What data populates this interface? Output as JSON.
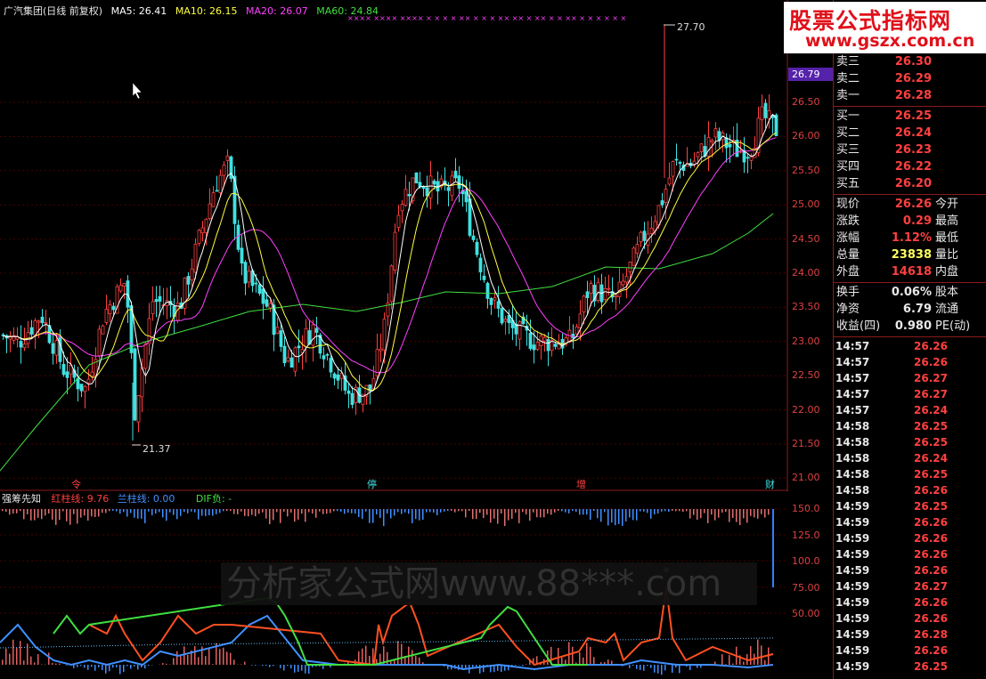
{
  "header": {
    "title": "广汽集团(日线 前复权)",
    "ma5": "MA5: 26.41",
    "ma10": "MA10: 26.15",
    "ma20": "MA20: 26.07",
    "ma60": "MA60: 24.84"
  },
  "colors": {
    "ma5": "#ffffff",
    "ma10": "#ffff40",
    "ma20": "#ff40ff",
    "ma60": "#40e040",
    "up": "#ff4040",
    "down": "#40e0e0"
  },
  "axis": {
    "price_ticks": [
      "26.50",
      "26.00",
      "25.50",
      "25.00",
      "24.50",
      "24.00",
      "23.50",
      "23.00",
      "22.50",
      "22.00",
      "21.50",
      "21.00"
    ],
    "indicator_ticks": [
      "150.0",
      "125.0",
      "100.0",
      "75.00",
      "50.00"
    ],
    "current_price": "26.79"
  },
  "annotations": {
    "high": "27.70",
    "low": "21.37",
    "markers": [
      "令",
      "停",
      "增",
      "财"
    ]
  },
  "indicator": {
    "name": "强筹先知",
    "red_label": "红柱线: 9.76",
    "blue_label": "兰柱线: 0.00",
    "dif_label": "DIF负: -"
  },
  "logo": {
    "line1": "股票公式指标网",
    "line2": "www.gszx.com.cn"
  },
  "watermark": "分析家公式网www.88***.com",
  "quote": {
    "sell": [
      {
        "label": "卖三",
        "value": "26.30"
      },
      {
        "label": "卖二",
        "value": "26.29"
      },
      {
        "label": "卖一",
        "value": "26.28"
      }
    ],
    "buy": [
      {
        "label": "买一",
        "value": "26.25"
      },
      {
        "label": "买二",
        "value": "26.24"
      },
      {
        "label": "买三",
        "value": "26.23"
      },
      {
        "label": "买四",
        "value": "26.22"
      },
      {
        "label": "买五",
        "value": "26.20"
      }
    ],
    "stats": [
      {
        "label": "现价",
        "value": "26.26",
        "right": "今开",
        "color": "#ff4040"
      },
      {
        "label": "涨跌",
        "value": "0.29",
        "right": "最高",
        "color": "#ff4040"
      },
      {
        "label": "涨幅",
        "value": "1.12%",
        "right": "最低",
        "color": "#ff4040"
      },
      {
        "label": "总量",
        "value": "23838",
        "right": "量比",
        "color": "#ffff60"
      },
      {
        "label": "外盘",
        "value": "14618",
        "right": "内盘",
        "color": "#ff4040"
      }
    ],
    "stats2": [
      {
        "label": "换手",
        "value": "0.06%",
        "right": "股本",
        "color": "#e8e8e8"
      },
      {
        "label": "净资",
        "value": "6.79",
        "right": "流通",
        "color": "#e8e8e8"
      },
      {
        "label": "收益(四)",
        "value": "0.980",
        "right": "PE(动)",
        "color": "#e8e8e8"
      }
    ]
  },
  "ticks": [
    {
      "time": "14:57",
      "price": "26.26"
    },
    {
      "time": "14:57",
      "price": "26.26"
    },
    {
      "time": "14:57",
      "price": "26.27"
    },
    {
      "time": "14:57",
      "price": "26.27"
    },
    {
      "time": "14:57",
      "price": "26.24"
    },
    {
      "time": "14:58",
      "price": "26.25"
    },
    {
      "time": "14:58",
      "price": "26.25"
    },
    {
      "time": "14:58",
      "price": "26.24"
    },
    {
      "time": "14:58",
      "price": "26.25"
    },
    {
      "time": "14:58",
      "price": "26.26"
    },
    {
      "time": "14:59",
      "price": "26.25"
    },
    {
      "time": "14:59",
      "price": "26.26"
    },
    {
      "time": "14:59",
      "price": "26.26"
    },
    {
      "time": "14:59",
      "price": "26.26"
    },
    {
      "time": "14:59",
      "price": "26.26"
    },
    {
      "time": "14:59",
      "price": "26.27"
    },
    {
      "time": "14:59",
      "price": "26.26"
    },
    {
      "time": "14:59",
      "price": "26.26"
    },
    {
      "time": "14:59",
      "price": "26.28"
    },
    {
      "time": "14:59",
      "price": "26.26"
    },
    {
      "time": "14:59",
      "price": "26.25"
    }
  ]
}
